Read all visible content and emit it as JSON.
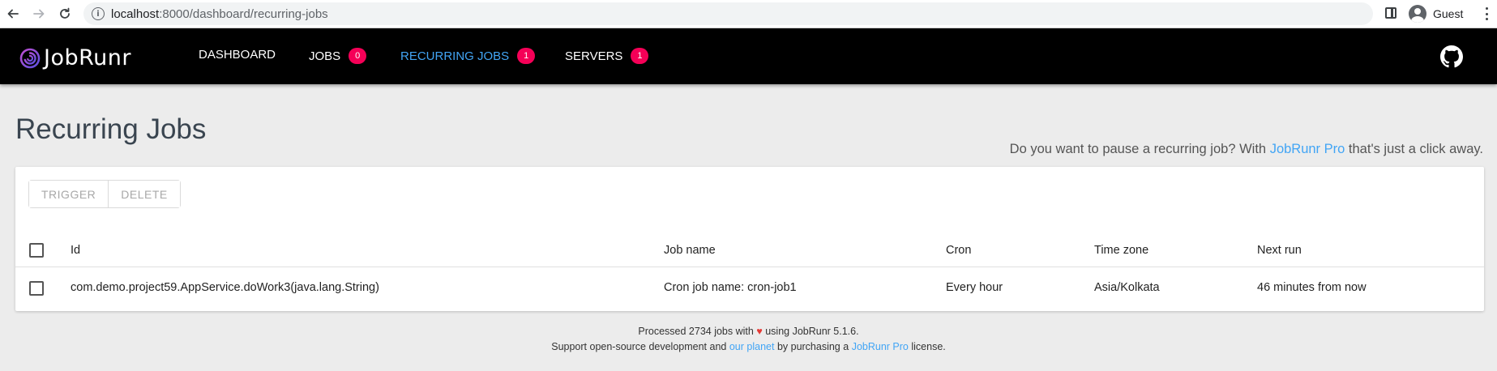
{
  "browser": {
    "url_host": "localhost",
    "url_path": ":8000/dashboard/recurring-jobs",
    "profile_name": "Guest"
  },
  "appbar": {
    "logo_text": "JobRunr",
    "nav": [
      {
        "label": "Dashboard",
        "badge": null
      },
      {
        "label": "Jobs",
        "badge": "0"
      },
      {
        "label": "Recurring Jobs",
        "badge": "1"
      },
      {
        "label": "Servers",
        "badge": "1"
      }
    ]
  },
  "page": {
    "title": "Recurring Jobs",
    "pro_hint_prefix": "Do you want to pause a recurring job? With",
    "pro_hint_link": "JobRunr Pro",
    "pro_hint_suffix": "that's just a click away."
  },
  "toolbar": {
    "trigger_label": "Trigger",
    "delete_label": "Delete"
  },
  "table": {
    "columns": [
      "Id",
      "Job name",
      "Cron",
      "Time zone",
      "Next run"
    ],
    "rows": [
      {
        "id": "com.demo.project59.AppService.doWork3(java.lang.String)",
        "job_name": "Cron job name: cron-job1",
        "cron": "Every hour",
        "time_zone": "Asia/Kolkata",
        "next_run": "46 minutes from now"
      }
    ]
  },
  "footer": {
    "line1_prefix": "Processed 2734 jobs with",
    "heart": "♥",
    "line1_suffix": "using JobRunr 5.1.6.",
    "line2_prefix": "Support open-source development and",
    "line2_link1": "our planet",
    "line2_middle": "by purchasing a",
    "line2_link2": "JobRunr Pro",
    "line2_suffix": "license."
  },
  "colors": {
    "accent": "#42a5f5",
    "badge": "#f50057",
    "appbar": "#000000",
    "heart": "#e53935"
  }
}
